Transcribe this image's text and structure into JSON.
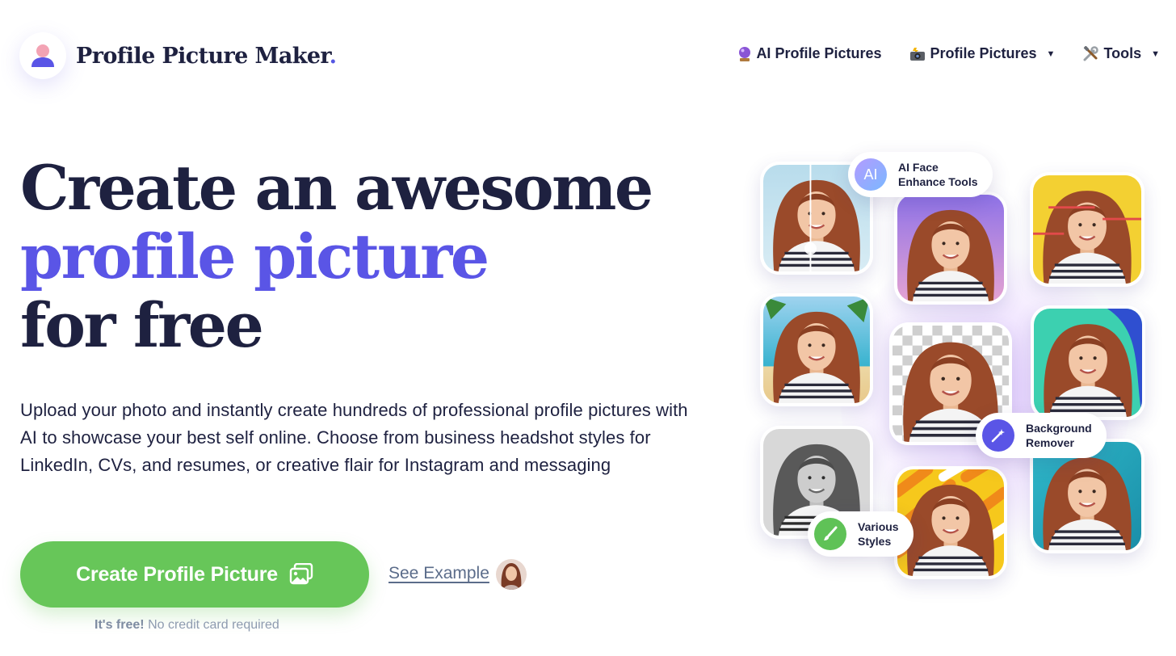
{
  "brand": {
    "name": "Profile Picture Maker",
    "dot": ".",
    "logo_icon": "user-avatar-icon",
    "accent_color": "#5a55e6"
  },
  "nav": {
    "items": [
      {
        "label": "AI Profile Pictures",
        "icon": "crystal-ball-icon",
        "has_dropdown": false
      },
      {
        "label": "Profile Pictures",
        "icon": "camera-flash-icon",
        "has_dropdown": true
      },
      {
        "label": "Tools",
        "icon": "hammer-wrench-icon",
        "has_dropdown": true
      }
    ],
    "caret": "▼"
  },
  "hero": {
    "line1": "Create an awesome",
    "line2": "profile picture",
    "line3": "for free",
    "description": "Upload your photo and instantly create hundreds of professional profile pictures with AI to showcase your best self online. Choose from business headshot styles for LinkedIn, CVs, and resumes, or creative flair for Instagram and messaging"
  },
  "cta": {
    "label": "Create Profile Picture",
    "icon": "image-gallery-icon",
    "color": "#67c659",
    "see_example": "See Example",
    "free_bold": "It's free!",
    "free_rest": "No credit card required"
  },
  "features": {
    "ai_icon_text": "AI",
    "ai_line1": "AI Face",
    "ai_line2": "Enhance Tools",
    "bg_line1": "Background",
    "bg_line2": "Remover",
    "styles_line1": "Various",
    "styles_line2": "Styles"
  }
}
